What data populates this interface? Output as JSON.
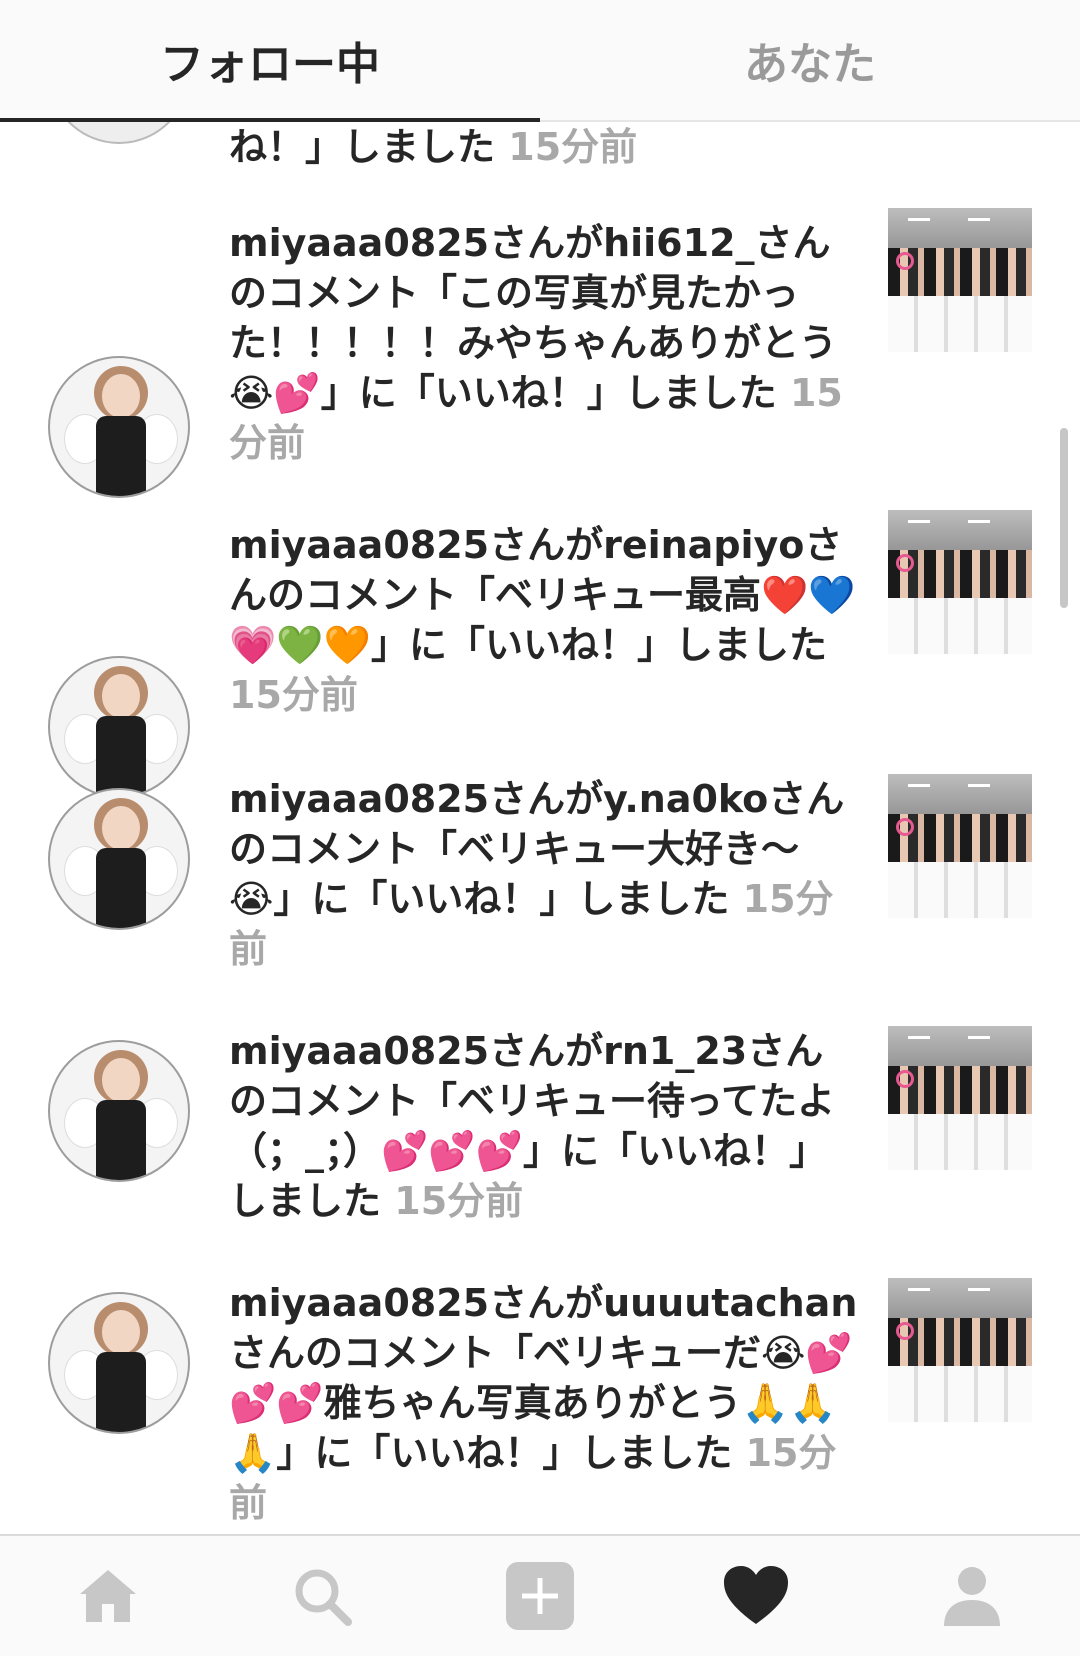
{
  "tabs": {
    "following": "フォロー中",
    "you": "あなた"
  },
  "partial_item": {
    "text": "ね！」しました",
    "time": "15分前"
  },
  "activities": [
    {
      "user": "miyaaa0825",
      "text": "miyaaa0825さんがhii612_さんのコメント「この写真が見たかった！！！！！みやちゃんありがとう😭💕」に「いいね！」しました",
      "time": "15分前"
    },
    {
      "user": "miyaaa0825",
      "text": "miyaaa0825さんがreinapiyoさんのコメント「ベリキュー最高❤️💙💗💚🧡」に「いいね！」しました",
      "time": "15分前"
    },
    {
      "user": "miyaaa0825",
      "text": "miyaaa0825さんがy.na0koさんのコメント「ベリキュー大好き〜😭」に「いいね！」しました",
      "time": "15分前"
    },
    {
      "user": "miyaaa0825",
      "text": "miyaaa0825さんがrn1_23さんのコメント「ベリキュー待ってたよ（；_；）💕💕💕」に「いいね！」しました",
      "time": "15分前"
    },
    {
      "user": "miyaaa0825",
      "text": "miyaaa0825さんがuuuutachanさんのコメント「ベリキューだ😭💕💕💕雅ちゃん写真ありがとう🙏🙏🙏」に「いいね！」しました",
      "time": "15分前"
    }
  ],
  "nav": {
    "home": "home-icon",
    "search": "search-icon",
    "add": "add-icon",
    "activity": "heart-icon",
    "profile": "profile-icon"
  },
  "colors": {
    "text": "#262626",
    "muted": "#a8a8a8",
    "inactive_icon": "#c7c7c7",
    "active_icon": "#262626"
  }
}
